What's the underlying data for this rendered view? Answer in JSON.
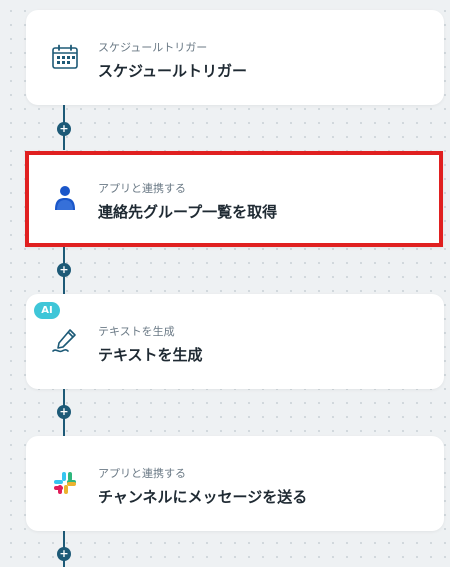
{
  "flow": {
    "steps": [
      {
        "subtitle": "スケジュールトリガー",
        "title": "スケジュールトリガー",
        "icon": "calendar-icon"
      },
      {
        "subtitle": "アプリと連携する",
        "title": "連絡先グループ一覧を取得",
        "icon": "contact-person-icon",
        "selected": true
      },
      {
        "subtitle": "テキストを生成",
        "title": "テキストを生成",
        "icon": "pen-icon",
        "badge": "AI"
      },
      {
        "subtitle": "アプリと連携する",
        "title": "チャンネルにメッセージを送る",
        "icon": "slack-icon"
      }
    ],
    "add_label": "+"
  },
  "colors": {
    "connector": "#1d5a77",
    "selection_border": "#e02020",
    "ai_badge": "#3fc6d8",
    "contact_icon": "#1a56c9"
  }
}
